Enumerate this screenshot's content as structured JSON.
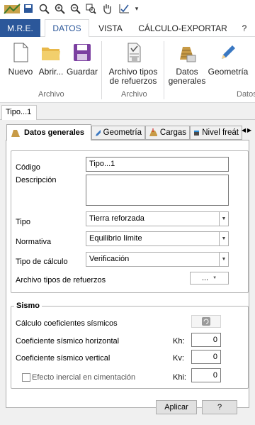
{
  "tabs": {
    "mre": "M.R.E.",
    "datos": "DATOS",
    "vista": "VISTA",
    "calculo": "CÁLCULO-EXPORTAR",
    "help": "?"
  },
  "ribbon": {
    "nuevo": "Nuevo",
    "abrir": "Abrir...",
    "guardar": "Guardar",
    "archivo_tipos_l1": "Archivo tipos",
    "archivo_tipos_l2": "de refuerzos",
    "datos_l1": "Datos",
    "datos_l2": "generales",
    "geometria": "Geometría",
    "group_archivo": "Archivo",
    "group_archivo2": "Archivo",
    "group_datos": "Datos"
  },
  "doc_tab": "Tipo...1",
  "inner_tabs": {
    "datos_generales": "Datos generales",
    "geometria": "Geometría",
    "cargas": "Cargas",
    "nivel_freatico": "Nivel freát"
  },
  "form": {
    "codigo_label": "Código",
    "codigo_value": "Tipo...1",
    "descripcion_label": "Descripción",
    "descripcion_value": "",
    "tipo_label": "Tipo",
    "tipo_value": "Tierra reforzada",
    "normativa_label": "Normativa",
    "normativa_value": "Equilibrio límite",
    "tipo_calculo_label": "Tipo de cálculo",
    "tipo_calculo_value": "Verificación",
    "archivo_label": "Archivo tipos de refuerzos",
    "archivo_btn": "..."
  },
  "sismo": {
    "title": "Sismo",
    "calculo_label": "Cálculo coeficientes sísmicos",
    "horizontal_label": "Coeficiente sísmico horizontal",
    "kh_label": "Kh:",
    "kh_value": "0",
    "vertical_label": "Coeficiente sísmico vertical",
    "kv_label": "Kv:",
    "kv_value": "0",
    "inercial_label": "Efecto inercial en cimentación",
    "khi_label": "Khi:",
    "khi_value": "0",
    "inercial_checked": false
  },
  "buttons": {
    "aplicar": "Aplicar",
    "help": "?"
  }
}
